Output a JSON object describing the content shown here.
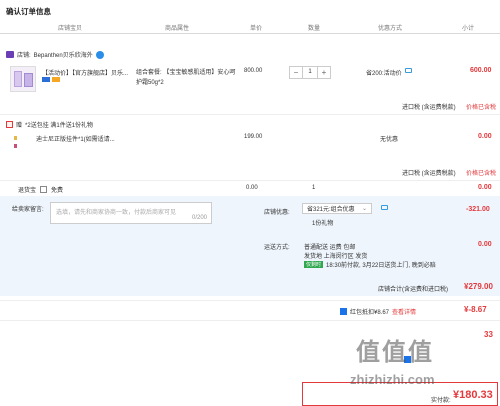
{
  "page_title": "确认订单信息",
  "columns": {
    "store": "店铺宝贝",
    "attr": "商品属性",
    "price": "单价",
    "qty": "数量",
    "promo": "优惠方式",
    "subtotal": "小计"
  },
  "store": {
    "prefix": "店铺:",
    "name": "Bepanthen贝乐欣海外"
  },
  "item1": {
    "title": "【活动价】【官方旗舰店】贝乐...",
    "attr": "组合套餐: 【宝宝敏感肌适用】安心呵护霜50g*2",
    "price": "800.00",
    "qty": "1",
    "promo": "省200:活动价",
    "subtotal": "600.00",
    "tax_label": "进口税 (含运费税款)",
    "tax_value": "价格已含税"
  },
  "gift": {
    "header_prefix": "赠",
    "header": "*2送包挂  满1件送1份礼物",
    "title": "迪士尼正版挂件*1(如需适请...",
    "price": "199.00",
    "promo": "无优惠",
    "subtotal": "0.00",
    "tax_label": "进口税 (含运费税款)",
    "tax_value": "价格已含税"
  },
  "insurance": {
    "label": "退货宝",
    "option": "免费",
    "price": "0.00",
    "qty": "1",
    "subtotal": "0.00"
  },
  "message": {
    "label": "给卖家留言:",
    "placeholder": "选填，请先和商家协商一致，付款后商家可见",
    "counter": "0/200"
  },
  "discount": {
    "label": "店铺优惠:",
    "selected": "省321元:组合优惠",
    "gift_note": "1份礼物",
    "amount": "-321.00"
  },
  "shipping": {
    "label": "运送方式:",
    "method": "普通配送 运费 包邮",
    "origin": "发货地 上海闵行区 发货",
    "tag": "仅剩时",
    "delivery": "18:30前付款, 3月22日送货上门, 晚到必赔",
    "amount": "0.00"
  },
  "store_total": {
    "label": "店铺合计(含运费和进口税)",
    "amount": "¥279.00"
  },
  "redpacket": {
    "label": "红包抵扣¥8.67",
    "link": "查看详情",
    "amount": "¥-8.67"
  },
  "row_33": "33",
  "pay": {
    "label": "实付款:",
    "amount": "¥180.33"
  },
  "watermark": {
    "logo": "值值值",
    "site": "zhizhizhi.com"
  },
  "colors": {
    "accent": "#e4393c",
    "link": "#1a73e8",
    "band": "#eef5fc"
  }
}
